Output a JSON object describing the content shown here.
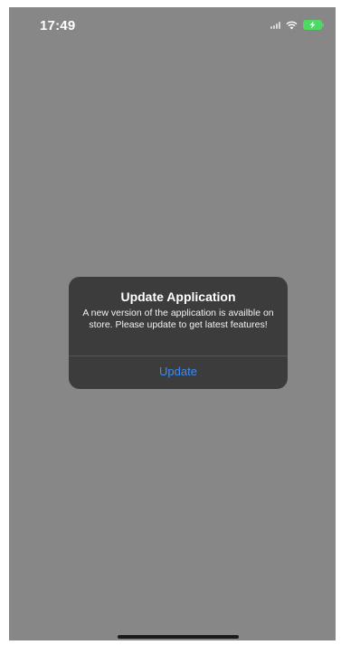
{
  "status_bar": {
    "time": "17:49",
    "icons": [
      "cellular-signal-icon",
      "wifi-icon",
      "battery-charging-icon"
    ],
    "battery_color": "#4cd964"
  },
  "alert": {
    "title": "Update Application",
    "message": "A new version of the application is availble on store. Please update to get latest features!",
    "action_label": "Update",
    "action_color": "#3d8cf5"
  }
}
